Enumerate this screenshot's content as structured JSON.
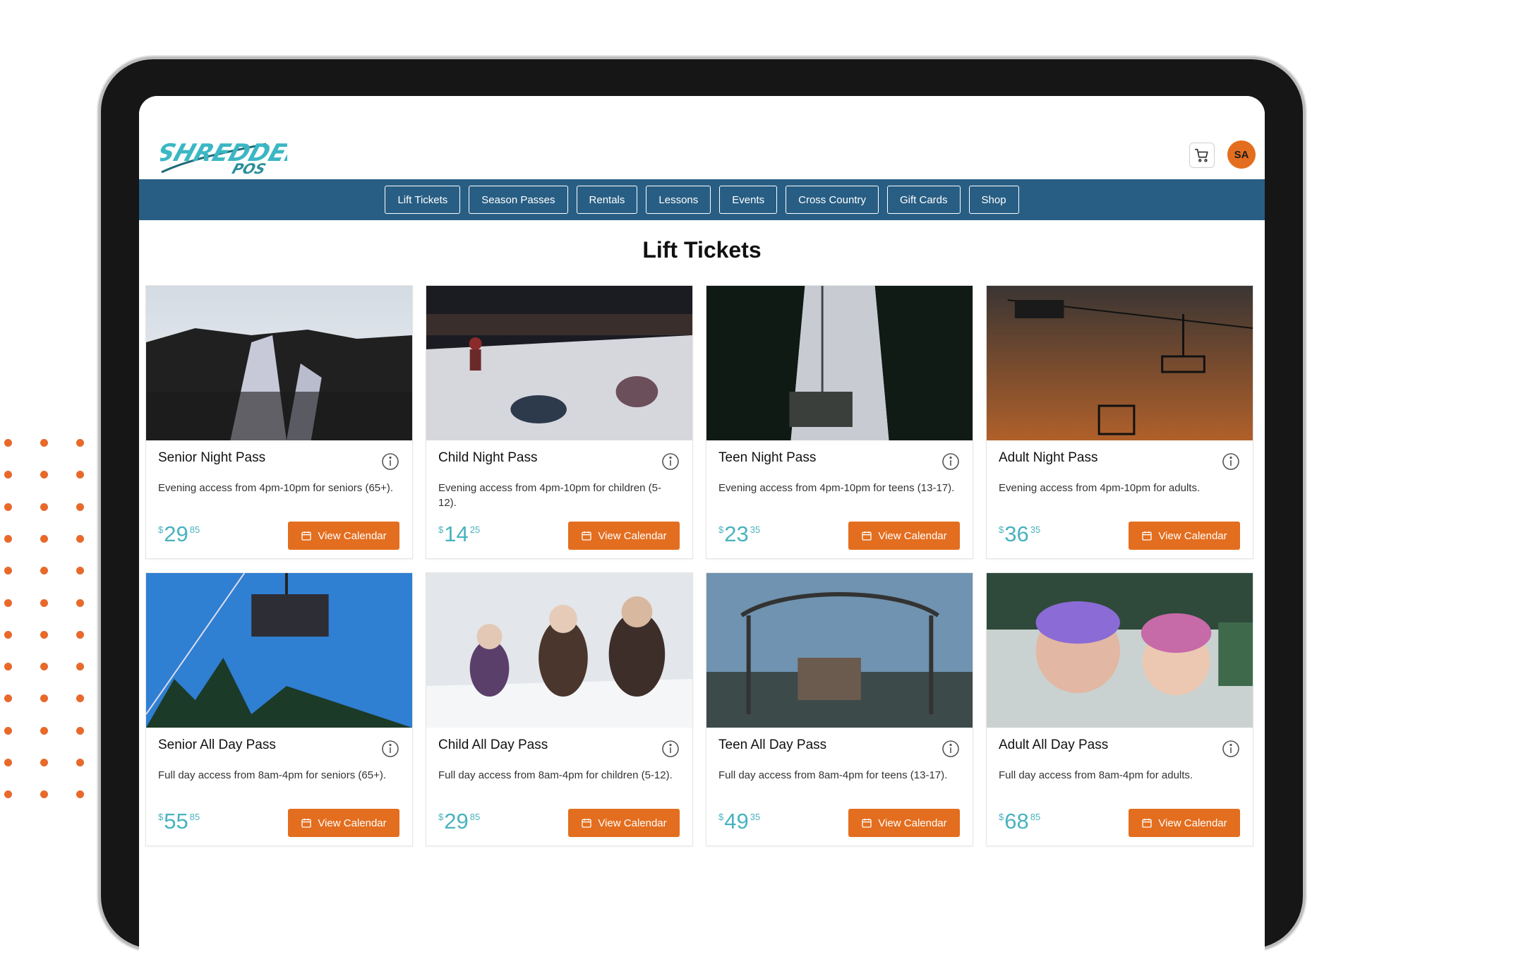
{
  "app": {
    "logo_text": "SHREDDER POS",
    "cart_icon": "cart-icon",
    "avatar_initials": "SA",
    "colors": {
      "accent": "#e36e1f",
      "nav": "#285e84",
      "price": "#49b3bf",
      "logo": "#3bb7c4"
    }
  },
  "nav": {
    "items": [
      "Lift Tickets",
      "Season Passes",
      "Rentals",
      "Lessons",
      "Events",
      "Cross Country",
      "Gift Cards",
      "Shop"
    ]
  },
  "page": {
    "title": "Lift Tickets"
  },
  "products": [
    {
      "title": "Senior Night Pass",
      "desc": "Evening access from 4pm-10pm for seniors (65+).",
      "currency": "$",
      "price_whole": "29",
      "price_cents": "85",
      "button": "View Calendar",
      "image": "night ski slope"
    },
    {
      "title": "Child Night Pass",
      "desc": "Evening access from 4pm-10pm for children (5-12).",
      "currency": "$",
      "price_whole": "14",
      "price_cents": "25",
      "button": "View Calendar",
      "image": "snowboarders at night"
    },
    {
      "title": "Teen Night Pass",
      "desc": "Evening access from 4pm-10pm for teens (13-17).",
      "currency": "$",
      "price_whole": "23",
      "price_cents": "35",
      "button": "View Calendar",
      "image": "chairlift through trees"
    },
    {
      "title": "Adult Night Pass",
      "desc": "Evening access from 4pm-10pm for adults.",
      "currency": "$",
      "price_whole": "36",
      "price_cents": "35",
      "button": "View Calendar",
      "image": "chairlift at sunset"
    },
    {
      "title": "Senior All Day Pass",
      "desc": "Full day access from 8am-4pm for seniors (65+).",
      "currency": "$",
      "price_whole": "55",
      "price_cents": "85",
      "button": "View Calendar",
      "image": "chairlift blue sky"
    },
    {
      "title": "Child All Day Pass",
      "desc": "Full day access from 8am-4pm for children (5-12).",
      "currency": "$",
      "price_whole": "29",
      "price_cents": "85",
      "button": "View Calendar",
      "image": "family in snow"
    },
    {
      "title": "Teen All Day Pass",
      "desc": "Full day access from 8am-4pm for teens (13-17).",
      "currency": "$",
      "price_whole": "49",
      "price_cents": "35",
      "button": "View Calendar",
      "image": "riders on chairlift"
    },
    {
      "title": "Adult All Day Pass",
      "desc": "Full day access from 8am-4pm for adults.",
      "currency": "$",
      "price_whole": "68",
      "price_cents": "85",
      "button": "View Calendar",
      "image": "couple with goggles"
    }
  ]
}
